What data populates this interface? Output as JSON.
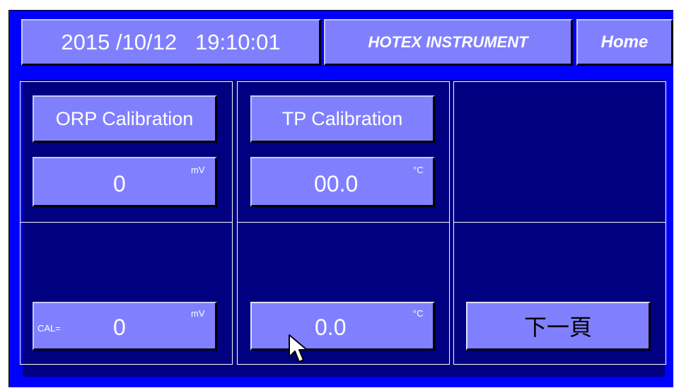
{
  "header": {
    "datetime": "2015 /10/12   19:10:01",
    "brand": "HOTEX INSTRUMENT",
    "home_label": "Home"
  },
  "orp": {
    "calibration_label": "ORP Calibration",
    "value": "0",
    "unit": "mV",
    "cal_prefix": "CAL=",
    "cal_value": "0",
    "cal_unit": "mV"
  },
  "tp": {
    "calibration_label": "TP Calibration",
    "value": "00.0",
    "unit": "°C",
    "cal_value": "0.0",
    "cal_unit": "°C"
  },
  "nav": {
    "next_page_label": "下一頁"
  },
  "colors": {
    "screen_bg": "#0000ff",
    "panel_bg": "#000080",
    "button_bg": "#8080ff"
  }
}
